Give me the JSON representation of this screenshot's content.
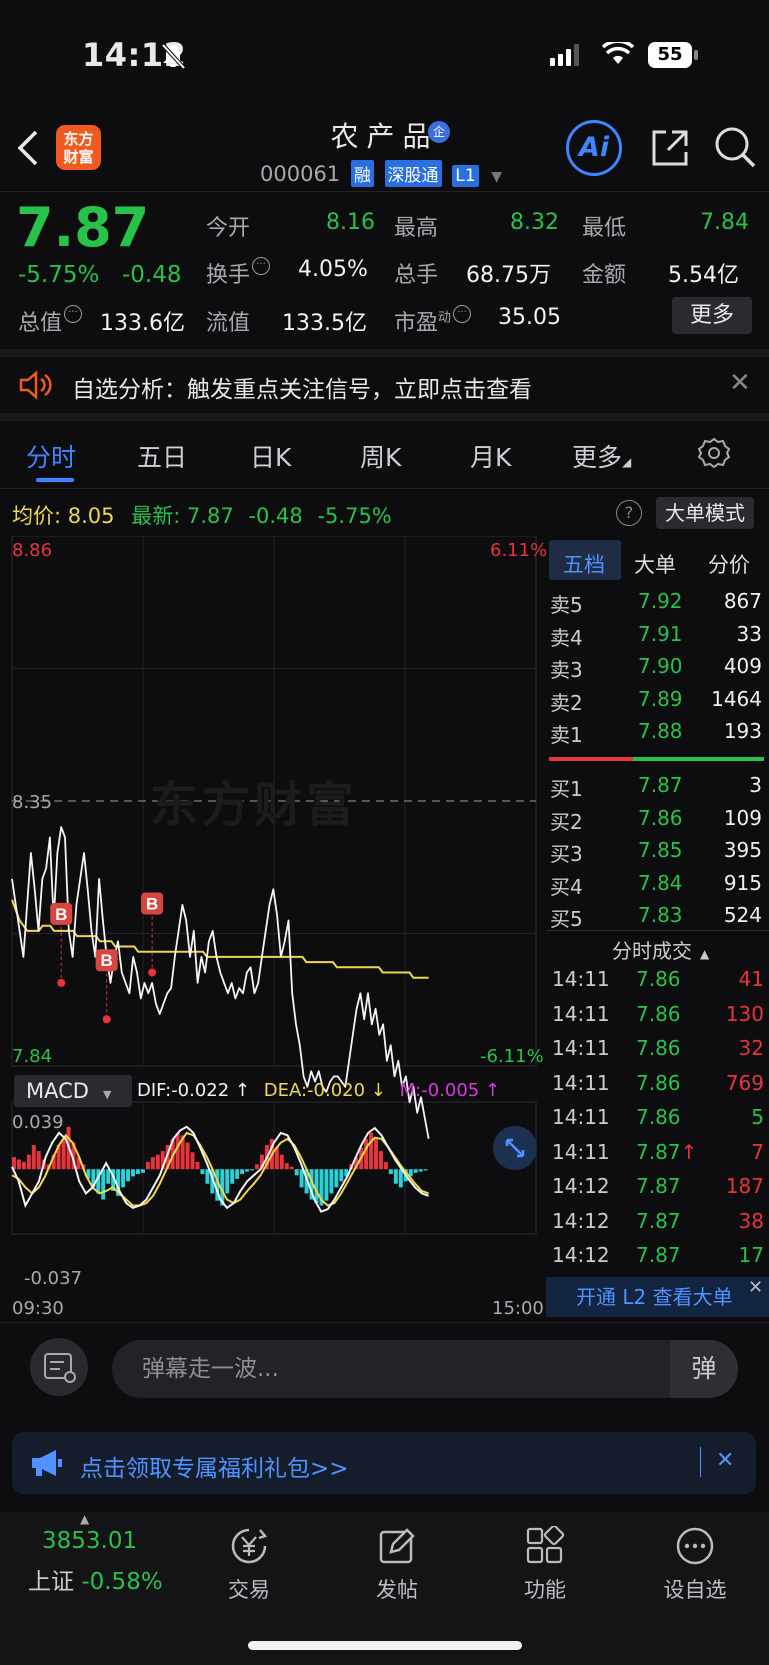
{
  "status_bar": {
    "time": "14:12",
    "battery": "55"
  },
  "header": {
    "logo_text_line1": "东方",
    "logo_text_line2": "财富",
    "stock_name": "农产品",
    "qi_badge": "企",
    "stock_code": "000061",
    "tags": [
      "融",
      "深股通",
      "L1"
    ],
    "ai_label": "Ai"
  },
  "quote": {
    "price": "7.87",
    "change_pct": "-5.75%",
    "change": "-0.48",
    "open_label": "今开",
    "open": "8.16",
    "high_label": "最高",
    "high": "8.32",
    "low_label": "最低",
    "low": "7.84",
    "turnover_label": "换手",
    "turnover": "4.05%",
    "volume_label": "总手",
    "volume": "68.75万",
    "amount_label": "金额",
    "amount": "5.54亿",
    "mktcap_label": "总值",
    "mktcap": "133.6亿",
    "float_label": "流值",
    "float_cap": "133.5亿",
    "pe_label": "市盈",
    "pe_sup": "动",
    "pe": "35.05",
    "more_label": "更多"
  },
  "banner": {
    "text": "自选分析：触发重点关注信号，立即点击查看"
  },
  "tabs": [
    {
      "label": "分时",
      "active": true
    },
    {
      "label": "五日"
    },
    {
      "label": "日K"
    },
    {
      "label": "周K"
    },
    {
      "label": "月K"
    },
    {
      "label": "更多"
    }
  ],
  "stats": {
    "avg_label": "均价:",
    "avg": "8.05",
    "latest_label": "最新:",
    "latest": "7.87",
    "latest_chg": "-0.48",
    "latest_pct": "-5.75%",
    "mode_label": "大单模式"
  },
  "chart_labels": {
    "top_price": "8.86",
    "top_pct": "6.11%",
    "mid_price": "8.35",
    "bottom_price": "7.84",
    "bottom_pct": "-6.11%",
    "macd_label": "MACD",
    "dif": "DIF:-0.022 ↑",
    "dea": "DEA:-0.020 ↓",
    "m": "M:-0.005 ↑",
    "macd_top": "0.039",
    "macd_bottom": "-0.037",
    "time_start": "09:30",
    "time_end": "15:00",
    "watermark": "东方财富",
    "buy_marker": "B"
  },
  "chart_data": {
    "type": "line",
    "y_range": [
      7.84,
      8.86
    ],
    "prev_close": 8.35,
    "x_range": [
      "09:30",
      "15:00"
    ],
    "series": [
      {
        "values": [
          8.2,
          8.15,
          8.1,
          8.05,
          8.15,
          8.25,
          8.18,
          8.1,
          8.2,
          8.22,
          8.28,
          8.12,
          8.25,
          8.3,
          8.28,
          8.1,
          8.05,
          8.15,
          8.2,
          8.25,
          8.18,
          8.1,
          8.05,
          8.2,
          8.12,
          8.05,
          8.0,
          8.05,
          8.08,
          8.02,
          8.0,
          7.98,
          8.05,
          8.02,
          7.97,
          8.0,
          7.98,
          8.0,
          7.96,
          7.94,
          7.96,
          7.98,
          7.99,
          8.05,
          8.1,
          8.15,
          8.12,
          8.05,
          8.1,
          8.0,
          8.05,
          8.02,
          8.08,
          8.1,
          8.05,
          8.02,
          8.0,
          7.98,
          8.0,
          7.97,
          7.99,
          7.98,
          8.02,
          8.03,
          7.98,
          8.0,
          8.05,
          8.1,
          8.15,
          8.18,
          8.13,
          8.05,
          8.08,
          8.12,
          7.98,
          7.92,
          7.88,
          7.82,
          7.8,
          7.83,
          7.81,
          7.83,
          7.8,
          7.79,
          7.81,
          7.82,
          7.82,
          7.81,
          7.8,
          7.85,
          7.9,
          7.95,
          7.98,
          7.93,
          7.98,
          7.92,
          7.95,
          7.9,
          7.92,
          7.85,
          7.88,
          7.82,
          7.85,
          7.8,
          7.82,
          7.77,
          7.8,
          7.75,
          7.78,
          7.74,
          7.7
        ]
      },
      {
        "values": [
          8.16,
          8.14,
          8.12,
          8.11,
          8.1,
          8.1,
          8.1,
          8.1,
          8.11,
          8.11,
          8.11,
          8.1,
          8.1,
          8.1,
          8.1,
          8.1,
          8.1,
          8.09,
          8.09,
          8.09,
          8.09,
          8.09,
          8.09,
          8.08,
          8.08,
          8.08,
          8.08,
          8.07,
          8.07,
          8.07,
          8.07,
          8.07,
          8.07,
          8.06,
          8.06,
          8.06,
          8.06,
          8.06,
          8.06,
          8.06,
          8.06,
          8.06,
          8.06,
          8.06,
          8.06,
          8.06,
          8.06,
          8.06,
          8.06,
          8.06,
          8.06,
          8.05,
          8.05,
          8.05,
          8.05,
          8.05,
          8.05,
          8.05,
          8.05,
          8.05,
          8.05,
          8.05,
          8.05,
          8.05,
          8.05,
          8.05,
          8.05,
          8.05,
          8.05,
          8.05,
          8.05,
          8.05,
          8.05,
          8.05,
          8.05,
          8.05,
          8.05,
          8.04,
          8.04,
          8.04,
          8.04,
          8.04,
          8.04,
          8.04,
          8.04,
          8.03,
          8.03,
          8.03,
          8.03,
          8.03,
          8.03,
          8.03,
          8.03,
          8.03,
          8.03,
          8.03,
          8.03,
          8.02,
          8.02,
          8.02,
          8.02,
          8.02,
          8.02,
          8.02,
          8.02,
          8.01,
          8.01,
          8.01,
          8.01,
          8.01
        ]
      }
    ],
    "buy_markers": [
      {
        "x_index": 13,
        "y": 8.0
      },
      {
        "x_index": 25,
        "y": 7.93
      },
      {
        "x_index": 37,
        "y": 8.02
      }
    ],
    "macd": {
      "y_range": [
        -0.037,
        0.039
      ],
      "hist": [
        0.01,
        0.008,
        0.006,
        0.012,
        0.02,
        0.015,
        0.008,
        0.004,
        0.012,
        0.02,
        0.025,
        0.035,
        0.022,
        0.01,
        0.004,
        -0.008,
        -0.015,
        -0.02,
        -0.025,
        -0.012,
        -0.018,
        -0.022,
        -0.015,
        -0.01,
        -0.006,
        -0.004,
        -0.003,
        0.006,
        0.01,
        0.012,
        0.015,
        0.02,
        0.025,
        0.03,
        0.028,
        0.022,
        0.014,
        0.006,
        -0.004,
        -0.012,
        -0.02,
        -0.026,
        -0.03,
        -0.02,
        -0.012,
        -0.008,
        -0.004,
        -0.002,
        -0.001,
        0.004,
        0.012,
        0.02,
        0.025,
        0.018,
        0.012,
        0.005,
        0.002,
        -0.005,
        -0.015,
        -0.02,
        -0.025,
        -0.028,
        -0.03,
        -0.026,
        -0.02,
        -0.015,
        -0.01,
        -0.006,
        0.004,
        0.01,
        0.018,
        0.025,
        0.03,
        0.025,
        0.015,
        0.006,
        -0.004,
        -0.012,
        -0.015,
        -0.01,
        -0.006,
        -0.003,
        -0.002,
        -0.001
      ],
      "dif": [
        0.002,
        -0.01,
        -0.03,
        -0.02,
        -0.01,
        0.01,
        0.022,
        0.03,
        0.025,
        0.01,
        -0.01,
        -0.02,
        -0.015,
        -0.005,
        0.005,
        -0.005,
        -0.018,
        -0.028,
        -0.032,
        -0.03,
        -0.025,
        -0.015,
        -0.005,
        0.01,
        0.025,
        0.032,
        0.035,
        0.03,
        0.018,
        0.005,
        -0.01,
        -0.025,
        -0.032,
        -0.028,
        -0.018,
        -0.01,
        -0.005,
        0.0,
        0.01,
        0.022,
        0.03,
        0.028,
        0.018,
        0.005,
        -0.01,
        -0.025,
        -0.035,
        -0.033,
        -0.025,
        -0.015,
        -0.005,
        0.008,
        0.02,
        0.03,
        0.034,
        0.028,
        0.018,
        0.008,
        0.0,
        -0.008,
        -0.015,
        -0.02,
        -0.022
      ],
      "dea": [
        -0.005,
        -0.008,
        -0.015,
        -0.02,
        -0.015,
        -0.005,
        0.008,
        0.02,
        0.028,
        0.022,
        0.01,
        -0.005,
        -0.015,
        -0.02,
        -0.018,
        -0.015,
        -0.02,
        -0.025,
        -0.03,
        -0.03,
        -0.028,
        -0.022,
        -0.012,
        0.0,
        0.012,
        0.022,
        0.03,
        0.028,
        0.02,
        0.01,
        -0.002,
        -0.015,
        -0.025,
        -0.028,
        -0.025,
        -0.018,
        -0.012,
        -0.005,
        0.005,
        0.015,
        0.022,
        0.025,
        0.02,
        0.01,
        -0.002,
        -0.015,
        -0.025,
        -0.03,
        -0.028,
        -0.02,
        -0.01,
        0.0,
        0.01,
        0.02,
        0.026,
        0.025,
        0.018,
        0.01,
        0.002,
        -0.005,
        -0.012,
        -0.018,
        -0.02
      ]
    }
  },
  "order_book": {
    "tabs": [
      "五档",
      "大单",
      "分价"
    ],
    "asks": [
      {
        "label": "卖5",
        "price": "7.92",
        "vol": "867"
      },
      {
        "label": "卖4",
        "price": "7.91",
        "vol": "33"
      },
      {
        "label": "卖3",
        "price": "7.90",
        "vol": "409"
      },
      {
        "label": "卖2",
        "price": "7.89",
        "vol": "1464"
      },
      {
        "label": "卖1",
        "price": "7.88",
        "vol": "193"
      }
    ],
    "bids": [
      {
        "label": "买1",
        "price": "7.87",
        "vol": "3"
      },
      {
        "label": "买2",
        "price": "7.86",
        "vol": "109"
      },
      {
        "label": "买3",
        "price": "7.85",
        "vol": "395"
      },
      {
        "label": "买4",
        "price": "7.84",
        "vol": "915"
      },
      {
        "label": "买5",
        "price": "7.83",
        "vol": "524"
      }
    ],
    "trades_title": "分时成交",
    "trades": [
      {
        "time": "14:11",
        "price": "7.86",
        "vol": "41",
        "vol_color": "red"
      },
      {
        "time": "14:11",
        "price": "7.86",
        "vol": "130",
        "vol_color": "red"
      },
      {
        "time": "14:11",
        "price": "7.86",
        "vol": "32",
        "vol_color": "red"
      },
      {
        "time": "14:11",
        "price": "7.86",
        "vol": "769",
        "vol_color": "red"
      },
      {
        "time": "14:11",
        "price": "7.86",
        "vol": "5",
        "vol_color": "green"
      },
      {
        "time": "14:11",
        "price": "7.87↑",
        "vol": "7",
        "vol_color": "red",
        "price_color": "red_arrow"
      },
      {
        "time": "14:12",
        "price": "7.87",
        "vol": "187",
        "vol_color": "red"
      },
      {
        "time": "14:12",
        "price": "7.87",
        "vol": "38",
        "vol_color": "red"
      },
      {
        "time": "14:12",
        "price": "7.87",
        "vol": "17",
        "vol_color": "green"
      }
    ],
    "l2_text": "开通 L2 查看大单"
  },
  "danmu": {
    "placeholder": "弹幕走一波...",
    "send_label": "弹"
  },
  "promo": {
    "text": "点击领取专属福利礼包>>"
  },
  "bottom_nav": {
    "index_value": "3853.01",
    "index_name": "上证",
    "index_pct": "-0.58%",
    "items": [
      "交易",
      "发帖",
      "功能",
      "设自选"
    ]
  },
  "colors": {
    "up": "#e8353b",
    "down": "#27c24a",
    "accent": "#3e86ff",
    "avg_line": "#f0d84b",
    "cyan": "#2ad1d6"
  }
}
